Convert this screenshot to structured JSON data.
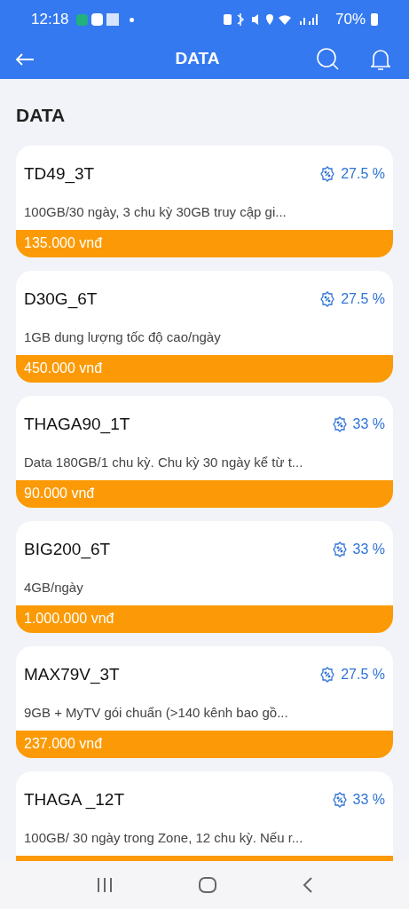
{
  "status_bar": {
    "time": "12:18",
    "battery": "70%"
  },
  "app_bar": {
    "title": "DATA"
  },
  "section_title": "DATA",
  "packages": [
    {
      "name": "TD49_3T",
      "discount": "27.5 %",
      "description": "100GB/30 ngày, 3 chu kỳ 30GB truy cập gi...",
      "price": "135.000 vnđ"
    },
    {
      "name": "D30G_6T",
      "discount": "27.5 %",
      "description": "1GB dung lượng tốc độ cao/ngày",
      "price": "450.000 vnđ"
    },
    {
      "name": "THAGA90_1T",
      "discount": "33 %",
      "description": "Data 180GB/1 chu kỳ. Chu kỳ 30 ngày kể từ t...",
      "price": "90.000 vnđ"
    },
    {
      "name": "BIG200_6T",
      "discount": "33 %",
      "description": "4GB/ngày",
      "price": "1.000.000 vnđ"
    },
    {
      "name": "MAX79V_3T",
      "discount": "27.5 %",
      "description": "9GB + MyTV gói chuẩn (>140 kênh bao gồ...",
      "price": "237.000 vnđ"
    },
    {
      "name": "THAGA _12T",
      "discount": "33 %",
      "description": "100GB/ 30 ngày trong Zone, 12 chu kỳ.  Nếu r..."
    }
  ]
}
